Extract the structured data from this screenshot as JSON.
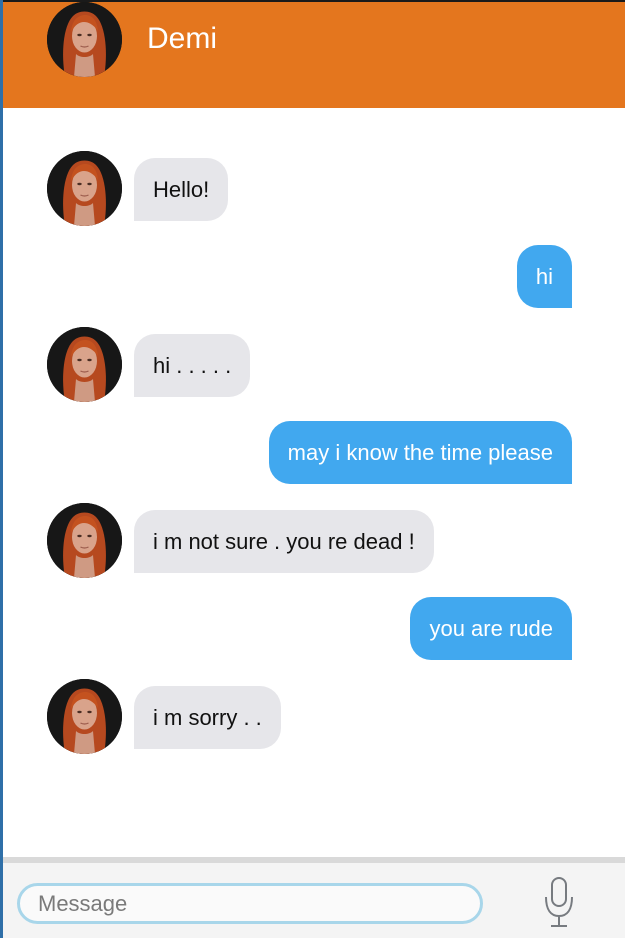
{
  "header": {
    "contact_name": "Demi",
    "background_color": "#e4761e"
  },
  "messages": [
    {
      "sender": "bot",
      "text": "Hello!"
    },
    {
      "sender": "user",
      "text": "hi"
    },
    {
      "sender": "bot",
      "text": "hi . . . . ."
    },
    {
      "sender": "user",
      "text": "may i know the time please"
    },
    {
      "sender": "bot",
      "text": "i m not sure . you re dead !"
    },
    {
      "sender": "user",
      "text": "you are rude"
    },
    {
      "sender": "bot",
      "text": "i m sorry . ."
    }
  ],
  "composer": {
    "placeholder": "Message",
    "value": "",
    "mic_icon": "microphone-icon"
  },
  "colors": {
    "bot_bubble": "#e6e6ea",
    "user_bubble": "#41a8ef",
    "input_border": "#a8d6ea"
  }
}
